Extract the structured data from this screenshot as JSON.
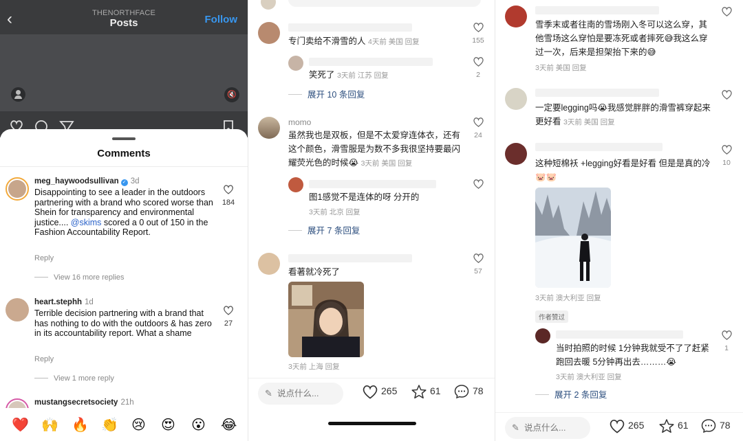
{
  "panel1": {
    "account": "THENORTHFACE",
    "title": "Posts",
    "follow_label": "Follow",
    "comments_title": "Comments",
    "comments": [
      {
        "user": "meg_haywoodsullivan",
        "verified": true,
        "time": "3d",
        "text_before": "Disappointing to see a leader in the outdoors partnering with a brand who scored worse than Shein for transparency and environmental justice.... ",
        "mention": "@skims",
        "text_after": " scored a 0 out of 150 in the Fashion Accountability Report.",
        "likes": "184",
        "reply_label": "Reply",
        "more_replies": "View 16 more replies"
      },
      {
        "user": "heart.stephh",
        "time": "1d",
        "text": "Terrible decision partnering with a brand that has nothing to do with the outdoors & has zero in its accountability report.  What a shame",
        "likes": "27",
        "reply_label": "Reply",
        "more_replies": "View 1 more reply"
      },
      {
        "user": "mustangsecretsociety",
        "time": "21h"
      }
    ],
    "emojis": [
      "❤️",
      "🙌",
      "🔥",
      "👏",
      "😢",
      "😍",
      "😮",
      "😂"
    ]
  },
  "panel2": {
    "comments": [
      {
        "text": "专门卖给不滑雪的人",
        "meta": "4天前 美国 回复",
        "likes": "155",
        "reply": {
          "text": "笑死了",
          "meta": "3天前 江苏 回复",
          "likes": "2"
        },
        "expand": "展开 10 条回复"
      },
      {
        "name": "momo",
        "text": "虽然我也是双板，但是不太爱穿连体衣，还有这个颜色，滑雪服是为数不多我很坚持要最闪耀荧光色的时候😭",
        "meta": "3天前 美国 回复",
        "likes": "24",
        "reply": {
          "text": "图1感觉不是连体的呀 分开的",
          "meta": "3天前 北京 回复"
        },
        "expand": "展开 7 条回复"
      },
      {
        "text": "看著就冷死了",
        "meta": "3天前 上海 回复",
        "likes": "57"
      }
    ],
    "bar": {
      "placeholder": "说点什么...",
      "likes": "265",
      "stars": "61",
      "comments": "78"
    }
  },
  "panel3": {
    "comments": [
      {
        "text": "雪季末或者往南的雪场刚入冬可以这么穿，其他雪场这么穿怕是要冻死或者摔死😅我这么穿过一次，后来是担架抬下来的😅",
        "meta": "3天前 美国 回复"
      },
      {
        "text": "一定要legging吗😭我感觉胖胖的滑雪裤穿起来更好看",
        "meta": "3天前 美国 回复"
      },
      {
        "text": "这种短棉袄 +legging好看是好看 但是是真的冷🐷🐷",
        "meta": "3天前 澳大利亚 回复",
        "likes": "10",
        "badge": "作者赞过",
        "reply": {
          "text": "当时拍照的时候 1分钟我就受不了了赶紧跑回去暖 5分钟再出去………😭",
          "meta": "3天前 澳大利亚 回复",
          "likes": "1"
        },
        "expand": "展开 2 条回复"
      }
    ],
    "bar": {
      "placeholder": "说点什么...",
      "likes": "265",
      "stars": "61",
      "comments": "78"
    }
  }
}
